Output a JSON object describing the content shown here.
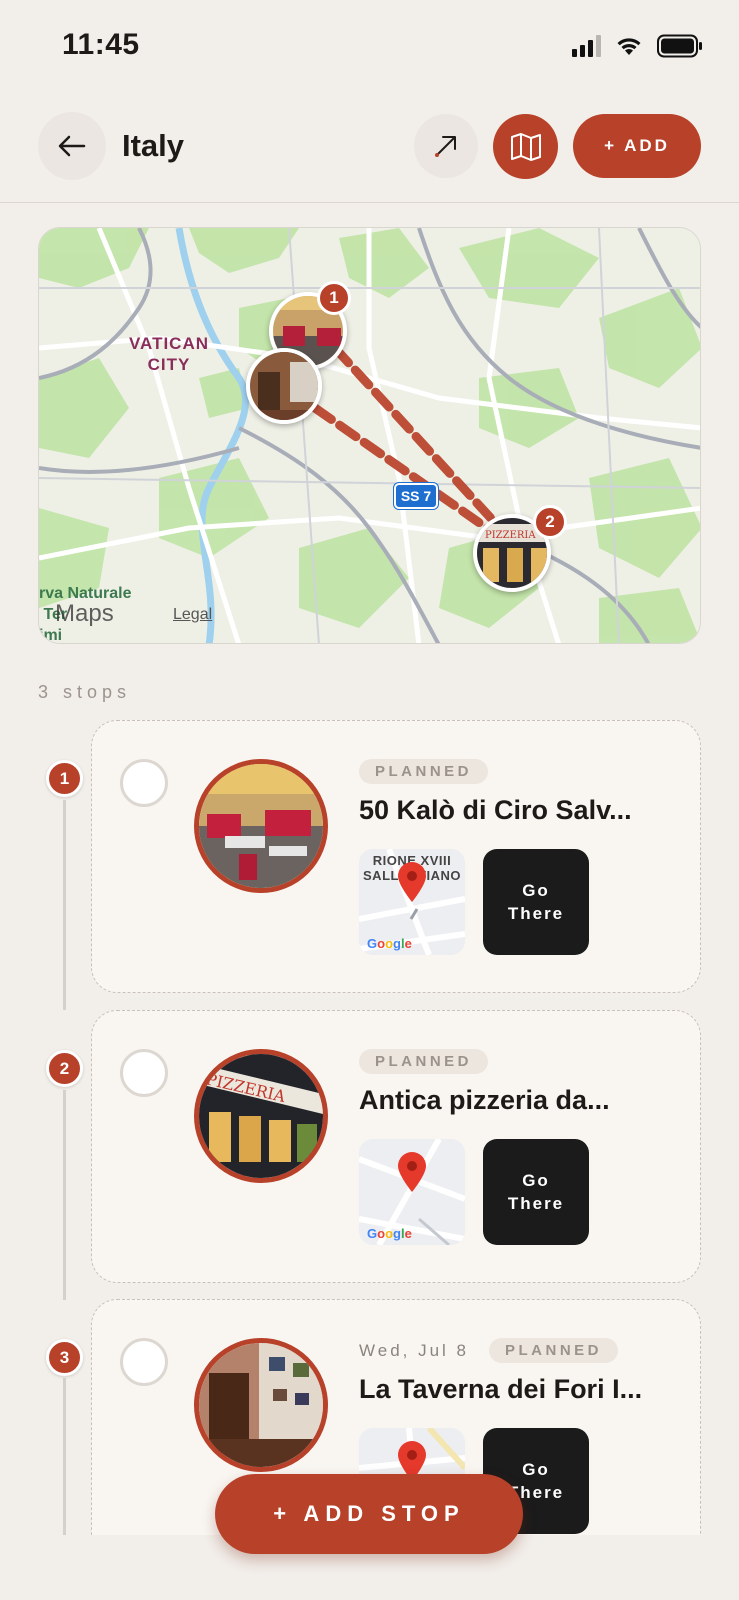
{
  "status_bar": {
    "time": "11:45"
  },
  "header": {
    "title": "Italy",
    "add_label": "+ ADD"
  },
  "map": {
    "vatican_label": "VATICAN CITY",
    "road_shield": "SS 7",
    "park_label": "rva Naturale\n Ter\nimi",
    "maps_logo": "Maps",
    "legal": "Legal",
    "pins": [
      "1",
      "2"
    ]
  },
  "stops_count": "3 stops",
  "stops": [
    {
      "number": "1",
      "date": "",
      "status": "PLANNED",
      "name": "50 Kalò di Ciro Salv...",
      "map_label": "RIONE XVIII SALLUSTIANO",
      "google": "Google",
      "go_label": "Go There"
    },
    {
      "number": "2",
      "date": "",
      "status": "PLANNED",
      "name": "Antica pizzeria da...",
      "map_label": "",
      "google": "Google",
      "go_label": "Go There"
    },
    {
      "number": "3",
      "date": "Wed, Jul 8",
      "status": "PLANNED",
      "name": "La Taverna dei Fori I...",
      "map_label": "",
      "google": "",
      "go_label": "Go There"
    }
  ],
  "add_stop_label": "+ ADD STOP",
  "colors": {
    "accent": "#b8412a",
    "background": "#f2eeea",
    "card": "#f9f6f2",
    "dark_button": "#1b1b1b"
  }
}
